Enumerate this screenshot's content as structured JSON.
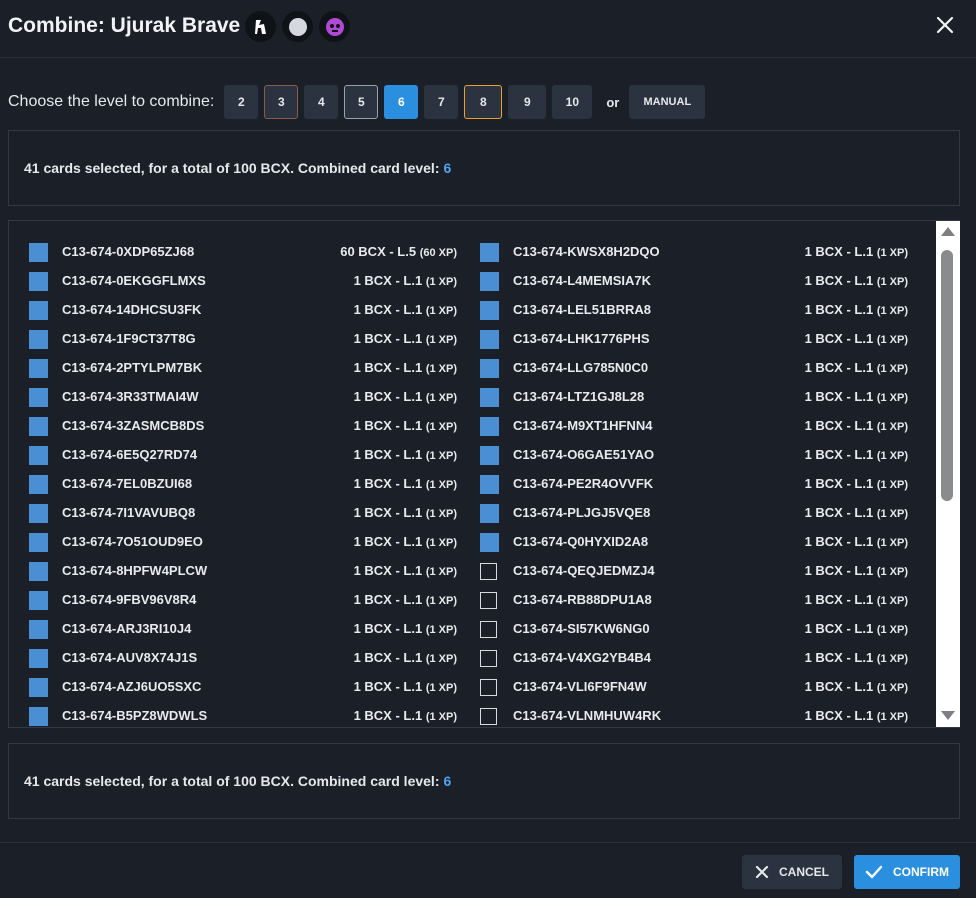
{
  "dialog": {
    "title": "Combine: Ujurak Brave",
    "level_prompt": "Choose the level to combine:",
    "levels": [
      {
        "label": "2",
        "state": "default"
      },
      {
        "label": "3",
        "state": "brown-outline"
      },
      {
        "label": "4",
        "state": "default"
      },
      {
        "label": "5",
        "state": "gray-outline"
      },
      {
        "label": "6",
        "state": "active"
      },
      {
        "label": "7",
        "state": "default"
      },
      {
        "label": "8",
        "state": "orange-outline"
      },
      {
        "label": "9",
        "state": "default"
      },
      {
        "label": "10",
        "state": "default"
      }
    ],
    "or_label": "or",
    "manual_label": "MANUAL",
    "summary": {
      "text": "41 cards selected, for a total of 100 BCX. Combined card level:",
      "level": "6"
    },
    "cancel_label": "CANCEL",
    "confirm_label": "CONFIRM"
  },
  "cards_left": [
    {
      "id": "C13-674-0XDP65ZJ68",
      "bcx": "60 BCX - L.5",
      "xp": "(60 XP)",
      "checked": true
    },
    {
      "id": "C13-674-0EKGGFLMXS",
      "bcx": "1 BCX - L.1",
      "xp": "(1 XP)",
      "checked": true
    },
    {
      "id": "C13-674-14DHCSU3FK",
      "bcx": "1 BCX - L.1",
      "xp": "(1 XP)",
      "checked": true
    },
    {
      "id": "C13-674-1F9CT37T8G",
      "bcx": "1 BCX - L.1",
      "xp": "(1 XP)",
      "checked": true
    },
    {
      "id": "C13-674-2PTYLPM7BK",
      "bcx": "1 BCX - L.1",
      "xp": "(1 XP)",
      "checked": true
    },
    {
      "id": "C13-674-3R33TMAI4W",
      "bcx": "1 BCX - L.1",
      "xp": "(1 XP)",
      "checked": true
    },
    {
      "id": "C13-674-3ZASMCB8DS",
      "bcx": "1 BCX - L.1",
      "xp": "(1 XP)",
      "checked": true
    },
    {
      "id": "C13-674-6E5Q27RD74",
      "bcx": "1 BCX - L.1",
      "xp": "(1 XP)",
      "checked": true
    },
    {
      "id": "C13-674-7EL0BZUI68",
      "bcx": "1 BCX - L.1",
      "xp": "(1 XP)",
      "checked": true
    },
    {
      "id": "C13-674-7I1VAVUBQ8",
      "bcx": "1 BCX - L.1",
      "xp": "(1 XP)",
      "checked": true
    },
    {
      "id": "C13-674-7O51OUD9EO",
      "bcx": "1 BCX - L.1",
      "xp": "(1 XP)",
      "checked": true
    },
    {
      "id": "C13-674-8HPFW4PLCW",
      "bcx": "1 BCX - L.1",
      "xp": "(1 XP)",
      "checked": true
    },
    {
      "id": "C13-674-9FBV96V8R4",
      "bcx": "1 BCX - L.1",
      "xp": "(1 XP)",
      "checked": true
    },
    {
      "id": "C13-674-ARJ3RI10J4",
      "bcx": "1 BCX - L.1",
      "xp": "(1 XP)",
      "checked": true
    },
    {
      "id": "C13-674-AUV8X74J1S",
      "bcx": "1 BCX - L.1",
      "xp": "(1 XP)",
      "checked": true
    },
    {
      "id": "C13-674-AZJ6UO5SXC",
      "bcx": "1 BCX - L.1",
      "xp": "(1 XP)",
      "checked": true
    },
    {
      "id": "C13-674-B5PZ8WDWLS",
      "bcx": "1 BCX - L.1",
      "xp": "(1 XP)",
      "checked": true
    }
  ],
  "cards_right": [
    {
      "id": "C13-674-KWSX8H2DQO",
      "bcx": "1 BCX - L.1",
      "xp": "(1 XP)",
      "checked": true
    },
    {
      "id": "C13-674-L4MEMSIA7K",
      "bcx": "1 BCX - L.1",
      "xp": "(1 XP)",
      "checked": true
    },
    {
      "id": "C13-674-LEL51BRRA8",
      "bcx": "1 BCX - L.1",
      "xp": "(1 XP)",
      "checked": true
    },
    {
      "id": "C13-674-LHK1776PHS",
      "bcx": "1 BCX - L.1",
      "xp": "(1 XP)",
      "checked": true
    },
    {
      "id": "C13-674-LLG785N0C0",
      "bcx": "1 BCX - L.1",
      "xp": "(1 XP)",
      "checked": true
    },
    {
      "id": "C13-674-LTZ1GJ8L28",
      "bcx": "1 BCX - L.1",
      "xp": "(1 XP)",
      "checked": true
    },
    {
      "id": "C13-674-M9XT1HFNN4",
      "bcx": "1 BCX - L.1",
      "xp": "(1 XP)",
      "checked": true
    },
    {
      "id": "C13-674-O6GAE51YAO",
      "bcx": "1 BCX - L.1",
      "xp": "(1 XP)",
      "checked": true
    },
    {
      "id": "C13-674-PE2R4OVVFK",
      "bcx": "1 BCX - L.1",
      "xp": "(1 XP)",
      "checked": true
    },
    {
      "id": "C13-674-PLJGJ5VQE8",
      "bcx": "1 BCX - L.1",
      "xp": "(1 XP)",
      "checked": true
    },
    {
      "id": "C13-674-Q0HYXID2A8",
      "bcx": "1 BCX - L.1",
      "xp": "(1 XP)",
      "checked": true
    },
    {
      "id": "C13-674-QEQJEDMZJ4",
      "bcx": "1 BCX - L.1",
      "xp": "(1 XP)",
      "checked": false
    },
    {
      "id": "C13-674-RB88DPU1A8",
      "bcx": "1 BCX - L.1",
      "xp": "(1 XP)",
      "checked": false
    },
    {
      "id": "C13-674-SI57KW6NG0",
      "bcx": "1 BCX - L.1",
      "xp": "(1 XP)",
      "checked": false
    },
    {
      "id": "C13-674-V4XG2YB4B4",
      "bcx": "1 BCX - L.1",
      "xp": "(1 XP)",
      "checked": false
    },
    {
      "id": "C13-674-VLI6F9FN4W",
      "bcx": "1 BCX - L.1",
      "xp": "(1 XP)",
      "checked": false
    },
    {
      "id": "C13-674-VLNMHUW4RK",
      "bcx": "1 BCX - L.1",
      "xp": "(1 XP)",
      "checked": false
    }
  ],
  "icons": {
    "ability": "ability-icon",
    "element": "neutral-element-icon",
    "monster": "monster-skull-icon",
    "close": "close-icon",
    "cancel": "x-icon",
    "confirm": "checkmark-icon"
  },
  "colors": {
    "background": "#1b1f27",
    "accent": "#2b8fe0",
    "checkbox_checked": "#4a8fd4",
    "button": "#2b3340",
    "monster_icon": "#b04ad6"
  }
}
